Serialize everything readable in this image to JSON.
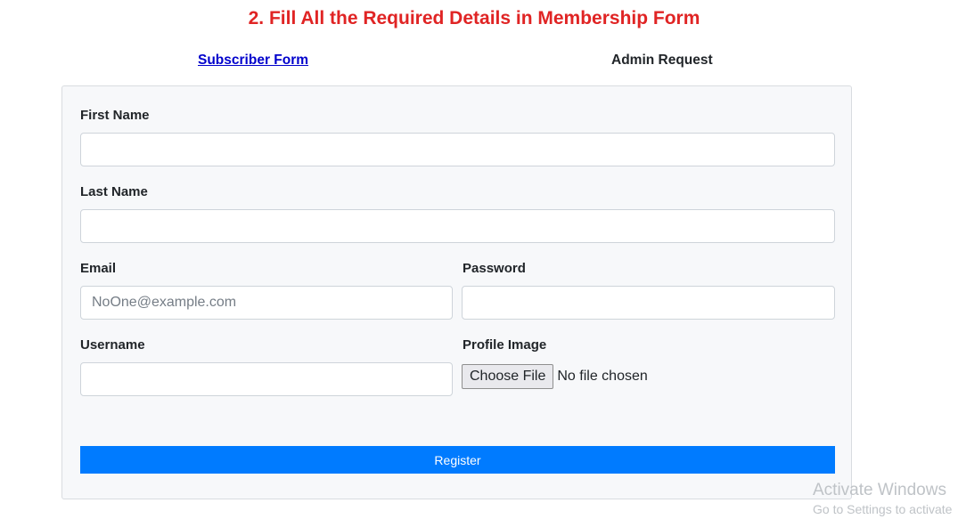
{
  "heading": "2. Fill All the Required Details in Membership Form",
  "tabs": {
    "subscriber": "Subscriber Form",
    "admin": "Admin Request"
  },
  "form": {
    "first_name": {
      "label": "First Name",
      "value": "",
      "placeholder": ""
    },
    "last_name": {
      "label": "Last Name",
      "value": "",
      "placeholder": ""
    },
    "email": {
      "label": "Email",
      "value": "",
      "placeholder": "NoOne@example.com"
    },
    "password": {
      "label": "Password",
      "value": "",
      "placeholder": ""
    },
    "username": {
      "label": "Username",
      "value": "",
      "placeholder": ""
    },
    "profile_image": {
      "label": "Profile Image",
      "button_label": "Choose File",
      "status": "No file chosen"
    },
    "submit_label": "Register"
  },
  "watermark": {
    "title": "Activate Windows",
    "subtitle": "Go to Settings to activate"
  },
  "colors": {
    "heading": "#e02424",
    "link": "#0000cc",
    "primary_button": "#007bff",
    "card_background": "#f7f8fa"
  }
}
